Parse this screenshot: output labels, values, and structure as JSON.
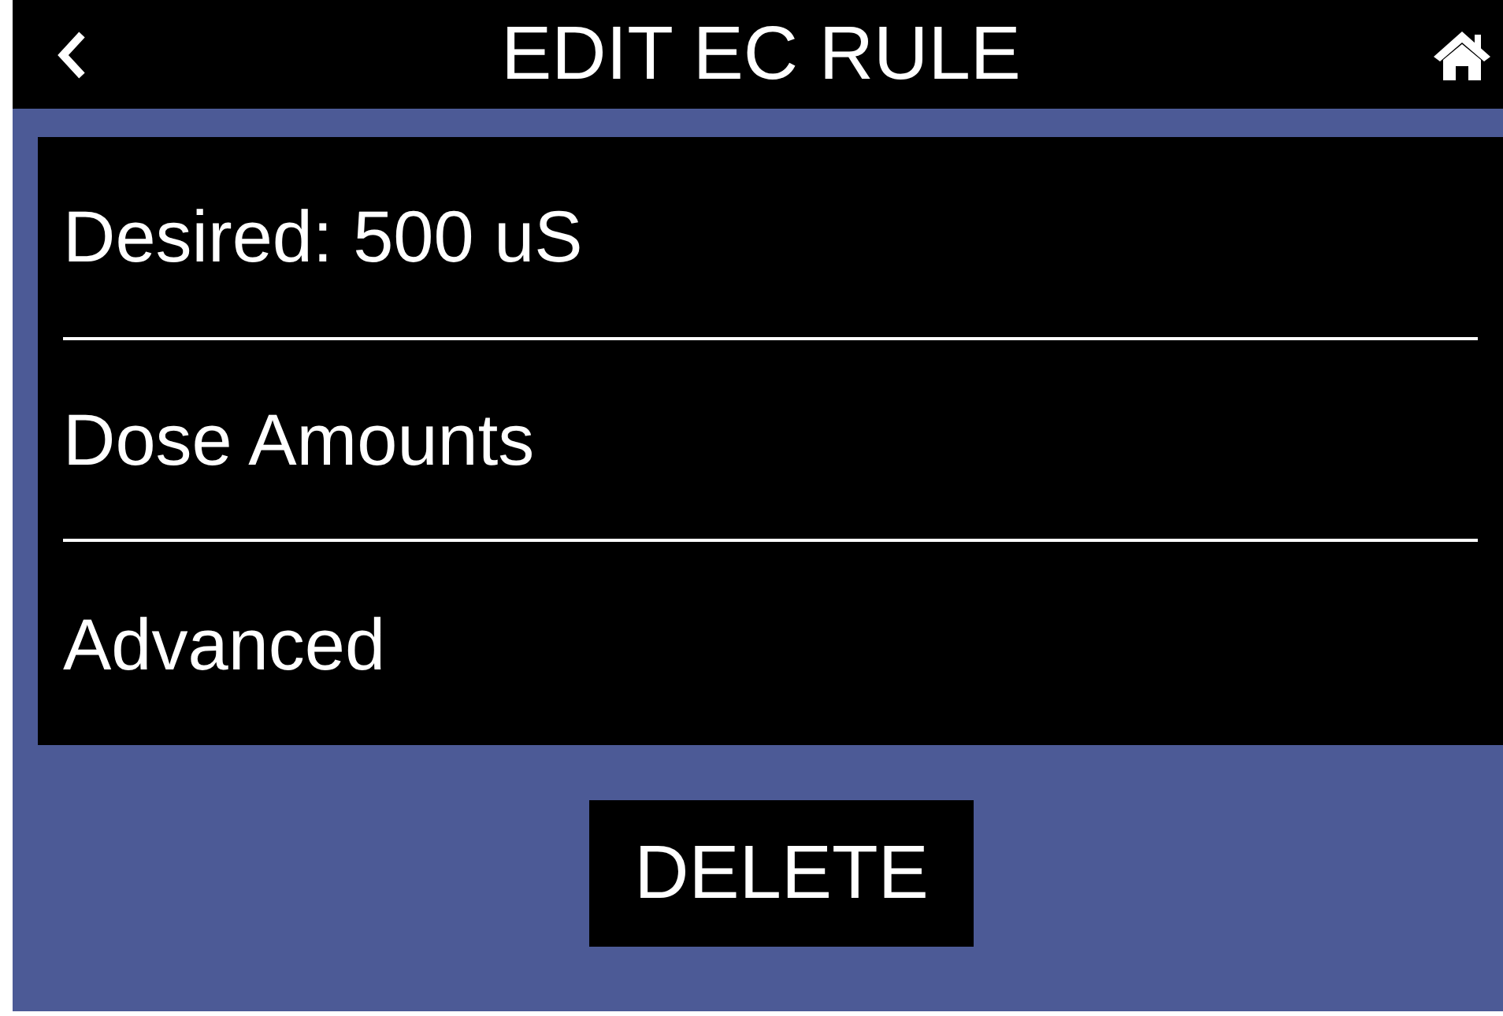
{
  "header": {
    "title": "EDIT EC RULE"
  },
  "menu_items": [
    {
      "label": "Desired: 500 uS"
    },
    {
      "label": "Dose Amounts"
    },
    {
      "label": "Advanced"
    }
  ],
  "delete_button": {
    "label": "DELETE"
  }
}
